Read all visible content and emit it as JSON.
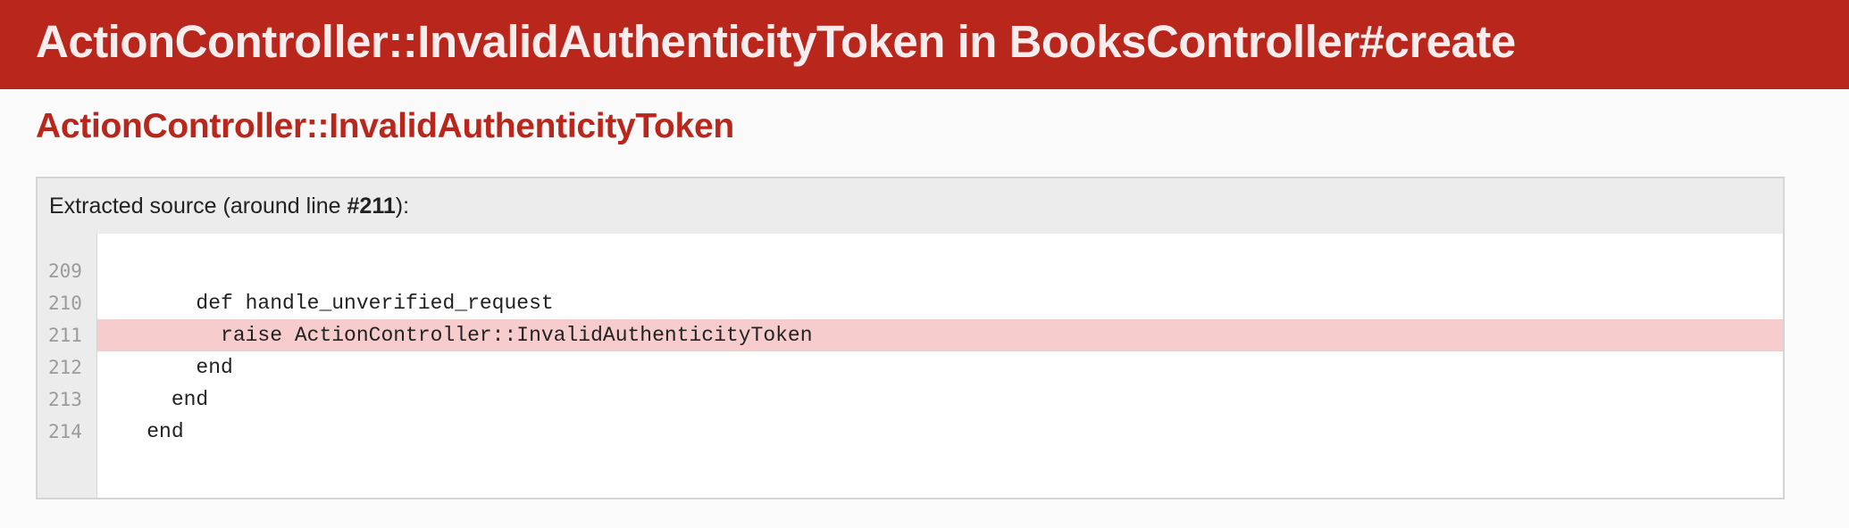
{
  "header": {
    "title": "ActionController::InvalidAuthenticityToken in BooksController#create"
  },
  "exception": {
    "name": "ActionController::InvalidAuthenticityToken"
  },
  "source": {
    "label_prefix": "Extracted source (around line ",
    "label_line": "#211",
    "label_suffix": "):",
    "lines": [
      {
        "number": "209",
        "code": ""
      },
      {
        "number": "210",
        "code": "        def handle_unverified_request"
      },
      {
        "number": "211",
        "code": "          raise ActionController::InvalidAuthenticityToken"
      },
      {
        "number": "212",
        "code": "        end"
      },
      {
        "number": "213",
        "code": "      end"
      },
      {
        "number": "214",
        "code": "    end"
      }
    ],
    "highlighted_line": "211"
  },
  "colors": {
    "header_bg": "#b9261c",
    "exception_text": "#b9261c",
    "highlight_bg": "#f7cccc"
  }
}
